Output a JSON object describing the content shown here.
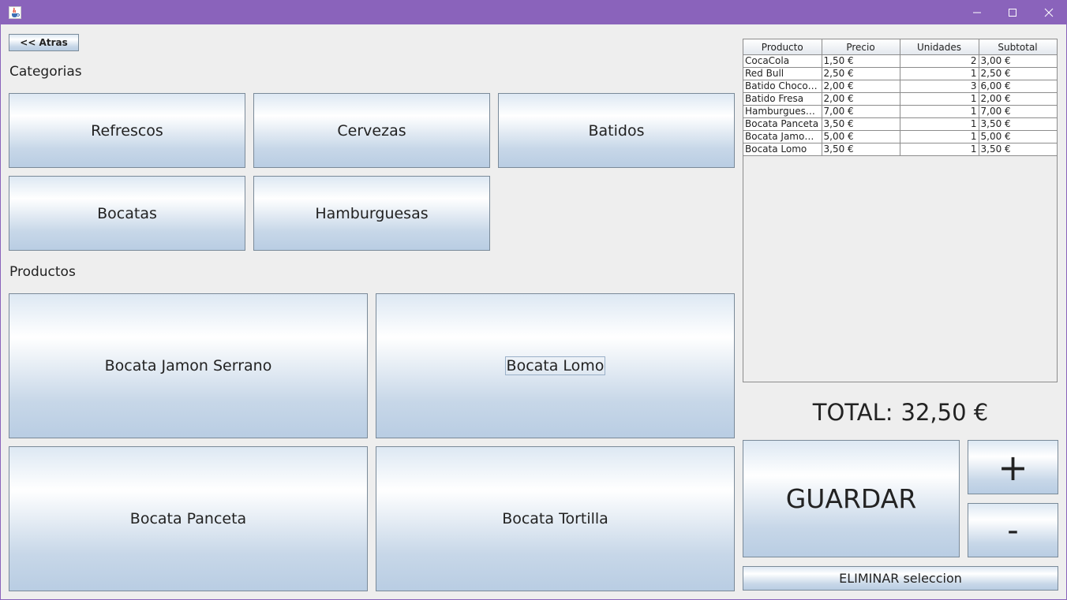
{
  "window": {
    "icon": "java-coffee-icon",
    "minimize_symbol": "—",
    "maximize_symbol": "☐",
    "close_symbol": "✕",
    "titlebar_color": "#8a63bb"
  },
  "nav": {
    "back_label": "<< Atras"
  },
  "categories": {
    "heading": "Categorias",
    "items": [
      "Refrescos",
      "Cervezas",
      "Batidos",
      "Bocatas",
      "Hamburguesas"
    ]
  },
  "products": {
    "heading": "Productos",
    "items": [
      "Bocata Jamon Serrano",
      "Bocata Lomo",
      "Bocata Panceta",
      "Bocata Tortilla"
    ],
    "focused": "Bocata Lomo"
  },
  "order": {
    "columns": [
      "Producto",
      "Precio",
      "Unidades",
      "Subtotal"
    ],
    "rows": [
      [
        "CocaCola",
        "1,50 €",
        "2",
        "3,00 €"
      ],
      [
        "Red Bull",
        "2,50 €",
        "1",
        "2,50 €"
      ],
      [
        "Batido Chocolate",
        "2,00 €",
        "3",
        "6,00 €"
      ],
      [
        "Batido Fresa",
        "2,00 €",
        "1",
        "2,00 €"
      ],
      [
        "Hamburguesa ...",
        "7,00 €",
        "1",
        "7,00 €"
      ],
      [
        "Bocata Panceta",
        "3,50 €",
        "1",
        "3,50 €"
      ],
      [
        "Bocata Jamon ...",
        "5,00 €",
        "1",
        "5,00 €"
      ],
      [
        "Bocata Lomo",
        "3,50 €",
        "1",
        "3,50 €"
      ]
    ]
  },
  "summary": {
    "total_label": "TOTAL:",
    "total_value": "32,50 €"
  },
  "actions": {
    "save_label": "GUARDAR",
    "plus_label": "+",
    "minus_label": "-",
    "delete_label": "ELIMINAR seleccion"
  }
}
